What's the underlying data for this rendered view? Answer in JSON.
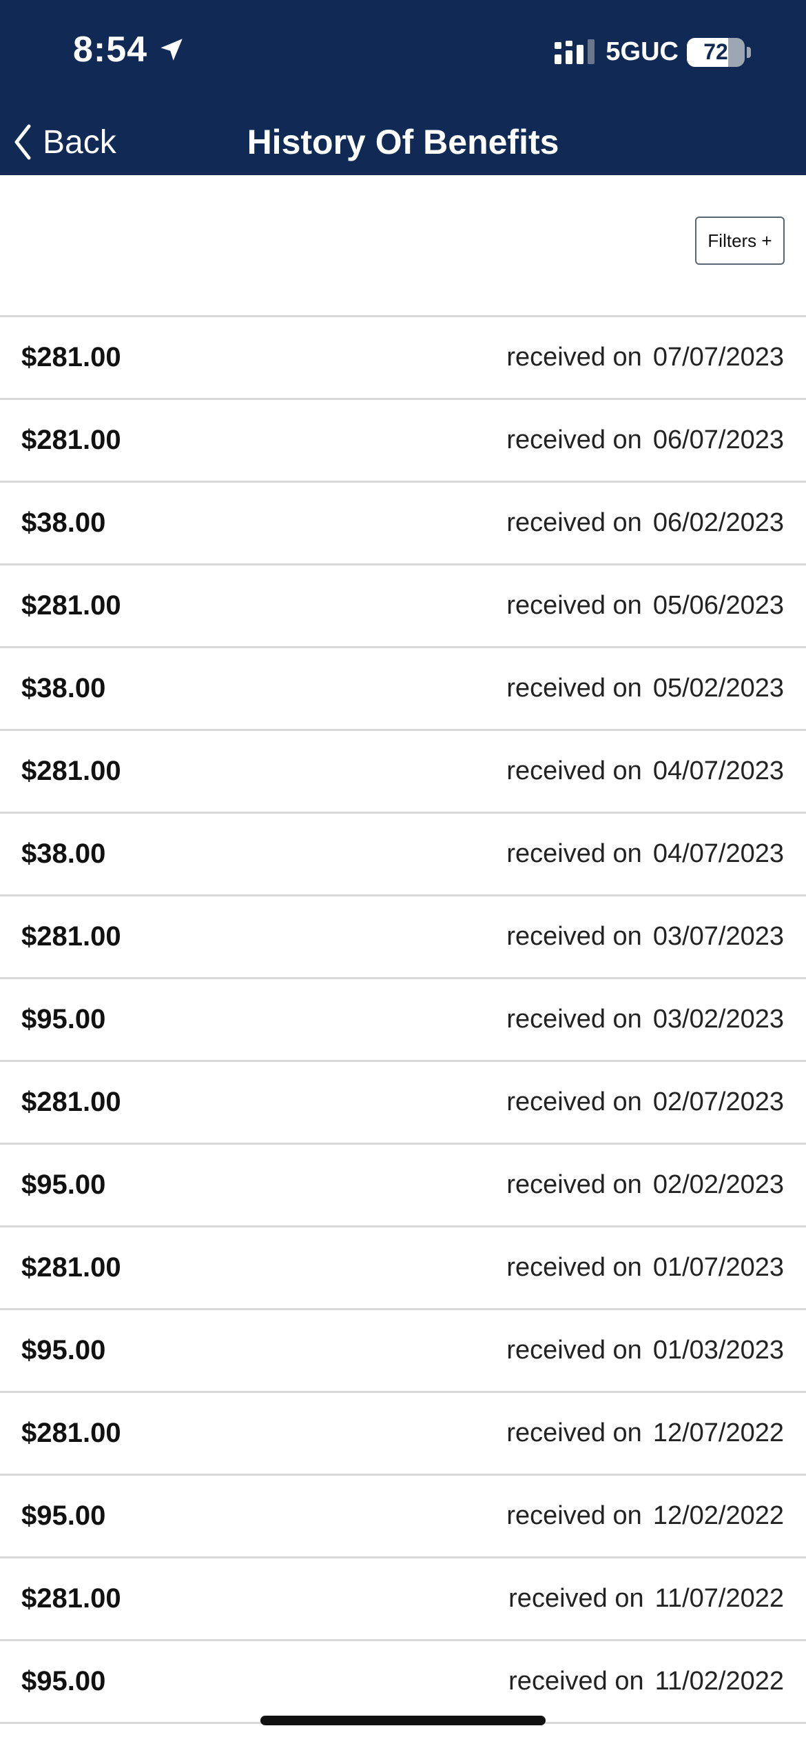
{
  "status_bar": {
    "time": "8:54",
    "network": "5GUC",
    "battery_percent": "72",
    "battery_level": 0.72,
    "icons": [
      "location-arrow-icon",
      "signal-bars-icon",
      "battery-icon"
    ]
  },
  "nav": {
    "back_label": "Back",
    "title": "History Of Benefits",
    "back_icon": "chevron-left-icon"
  },
  "filters": {
    "label": "Filters +"
  },
  "received_prefix": "received on",
  "benefits": [
    {
      "amount": "$281.00",
      "date": "07/07/2023"
    },
    {
      "amount": "$281.00",
      "date": "06/07/2023"
    },
    {
      "amount": "$38.00",
      "date": "06/02/2023"
    },
    {
      "amount": "$281.00",
      "date": "05/06/2023"
    },
    {
      "amount": "$38.00",
      "date": "05/02/2023"
    },
    {
      "amount": "$281.00",
      "date": "04/07/2023"
    },
    {
      "amount": "$38.00",
      "date": "04/07/2023"
    },
    {
      "amount": "$281.00",
      "date": "03/07/2023"
    },
    {
      "amount": "$95.00",
      "date": "03/02/2023"
    },
    {
      "amount": "$281.00",
      "date": "02/07/2023"
    },
    {
      "amount": "$95.00",
      "date": "02/02/2023"
    },
    {
      "amount": "$281.00",
      "date": "01/07/2023"
    },
    {
      "amount": "$95.00",
      "date": "01/03/2023"
    },
    {
      "amount": "$281.00",
      "date": "12/07/2022"
    },
    {
      "amount": "$95.00",
      "date": "12/02/2022"
    },
    {
      "amount": "$281.00",
      "date": "11/07/2022"
    },
    {
      "amount": "$95.00",
      "date": "11/02/2022"
    }
  ],
  "colors": {
    "header_background": "#112a55",
    "divider": "#d7d7d7"
  }
}
